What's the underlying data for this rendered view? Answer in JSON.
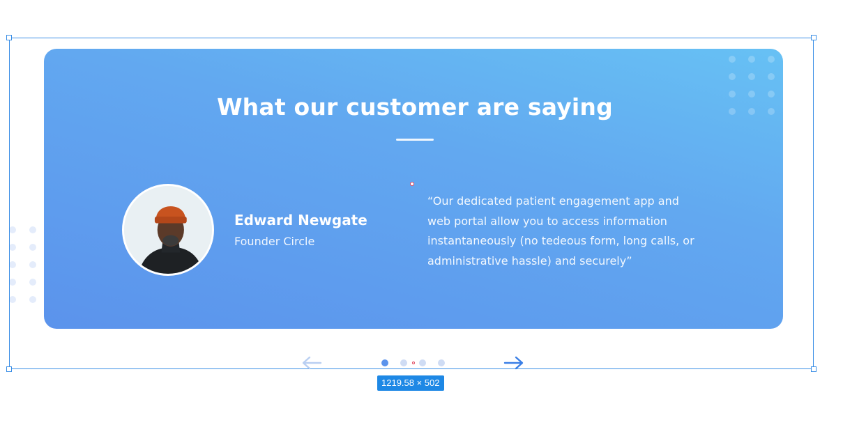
{
  "testimonial": {
    "title": "What our customer are saying",
    "name": "Edward Newgate",
    "role": "Founder Circle",
    "quote": "“Our dedicated patient engagement app and web portal allow you to access information instantaneously (no tedeous form, long calls, or administrative hassle) and securely”"
  },
  "slider": {
    "page_count": 4,
    "active_index": 0
  },
  "editor": {
    "dimension_label": "1219.58 × 502"
  },
  "colors": {
    "card_gradient_start": "#67c1f4",
    "card_gradient_end": "#5b93ec",
    "accent": "#3a8ee6",
    "inactive_dot": "#cfdcf4"
  },
  "icons": {
    "prev": "arrow-left-icon",
    "next": "arrow-right-icon"
  }
}
